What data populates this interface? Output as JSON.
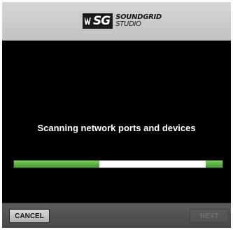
{
  "logo": {
    "abbr": "SG",
    "line1": "SOUNDGRID",
    "line2": "STUDIO"
  },
  "main": {
    "status_text": "Scanning network ports and devices",
    "progress": {
      "segments": [
        {
          "start": 0.0,
          "end": 0.41
        },
        {
          "start": 0.92,
          "end": 1.0
        }
      ],
      "fill_color": "#4caf3a"
    }
  },
  "footer": {
    "cancel_label": "CANCEL",
    "next_label": "NEXT",
    "next_enabled": false
  },
  "colors": {
    "header_bg": "#c9c9c9",
    "body_bg": "#000000",
    "footer_bg": "#505050",
    "accent": "#4caf3a"
  },
  "icons": {
    "logo_mark": "waves-sg-logo-icon"
  }
}
